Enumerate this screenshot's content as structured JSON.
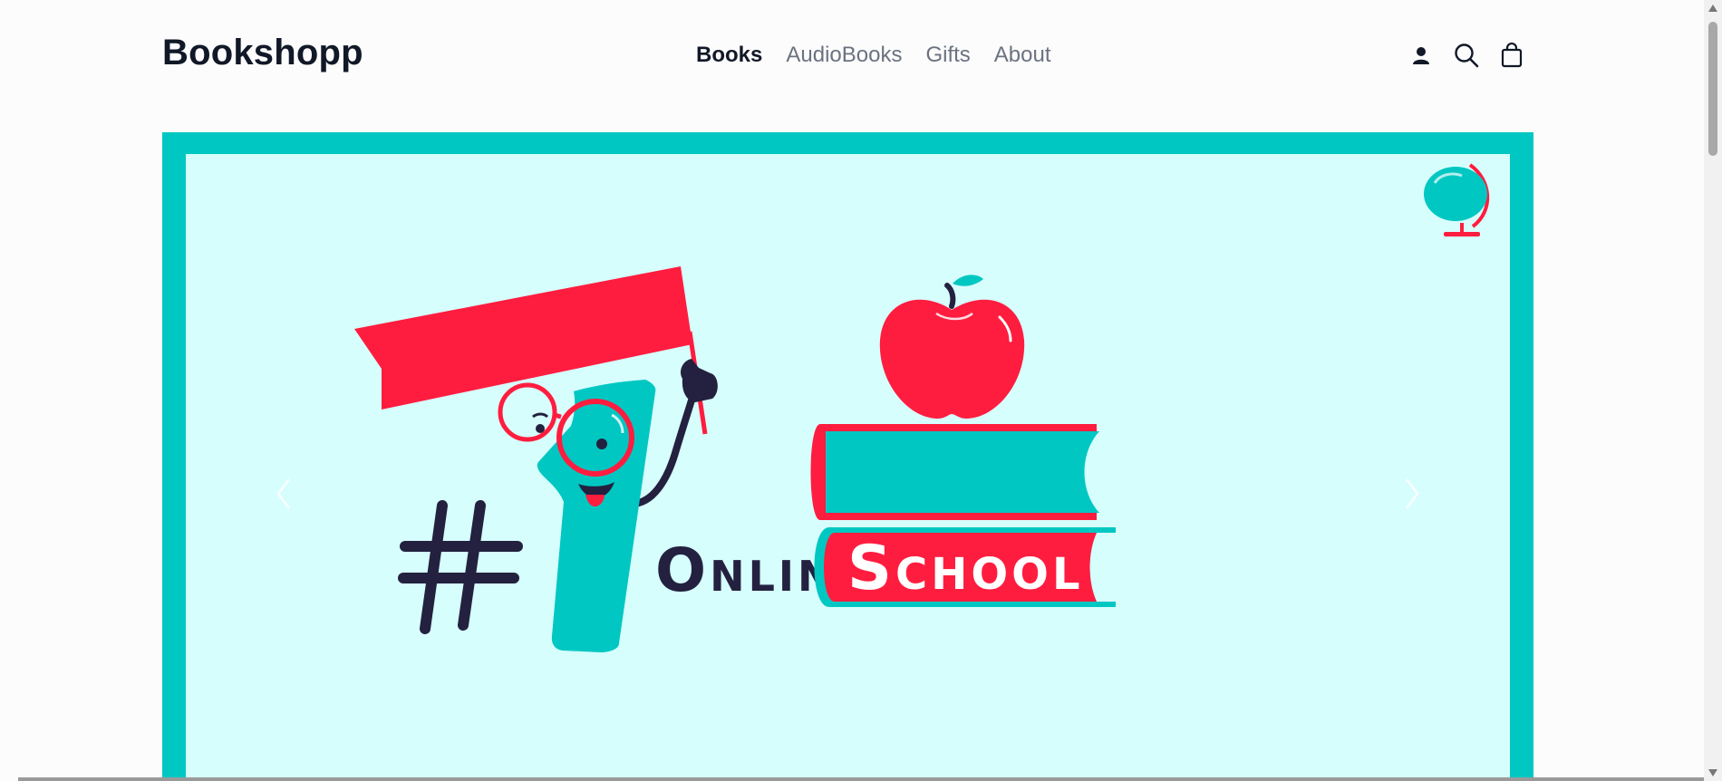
{
  "header": {
    "brand": "Bookshopp",
    "nav": [
      {
        "label": "Books",
        "active": true
      },
      {
        "label": "AudioBooks",
        "active": false
      },
      {
        "label": "Gifts",
        "active": false
      },
      {
        "label": "About",
        "active": false
      }
    ],
    "icons": [
      "account-icon",
      "search-icon",
      "shopping-bag-icon"
    ]
  },
  "hero": {
    "banner_text_prefix": "#1",
    "banner_word_1": "Online",
    "banner_word_2": "School",
    "colors": {
      "frame": "#00c7c2",
      "background": "#d6fefd",
      "accent_red": "#ff1d3f",
      "dark": "#23213f",
      "teal": "#00c7c2"
    }
  }
}
